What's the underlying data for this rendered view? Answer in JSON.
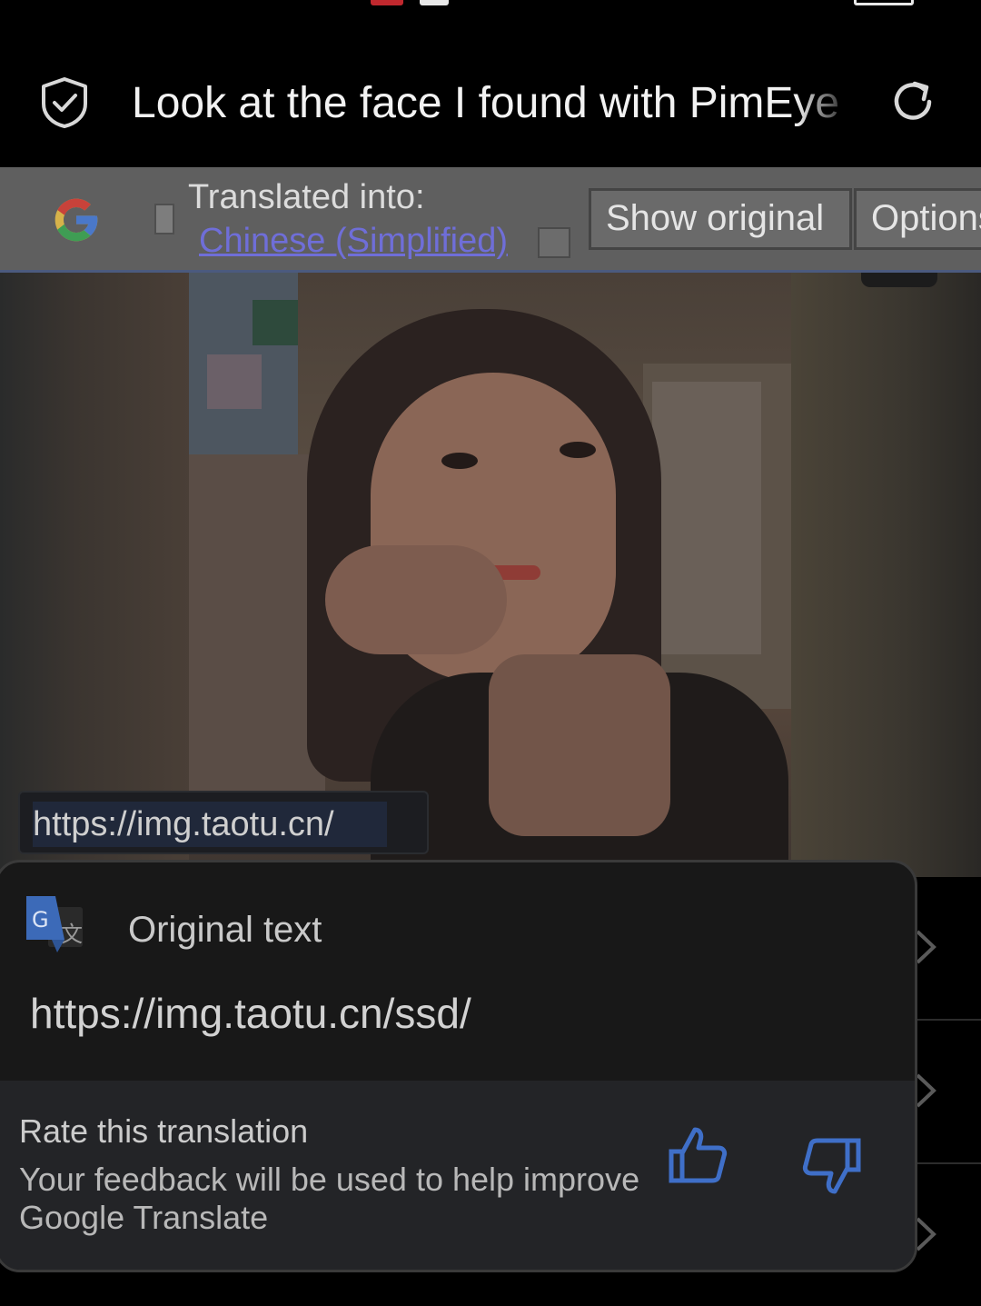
{
  "browser": {
    "page_title": "Look at the face I found with PimEye"
  },
  "translate_bar": {
    "label": "Translated into:",
    "language": "Chinese (Simplified)",
    "show_original": "Show original",
    "options": "Options"
  },
  "content": {
    "url_chip": "https://img.taotu.cn/"
  },
  "popup": {
    "original_label": "Original text",
    "original_url": "https://img.taotu.cn/ssd/",
    "rate_title": "Rate this translation",
    "rate_description": "Your feedback will be used to help improve Google Translate"
  },
  "colors": {
    "link": "#6f6ed8",
    "thumb_icons": "#3f6fc8",
    "popup_bg": "#181818",
    "translate_bar_bg": "#5f5f5f"
  }
}
